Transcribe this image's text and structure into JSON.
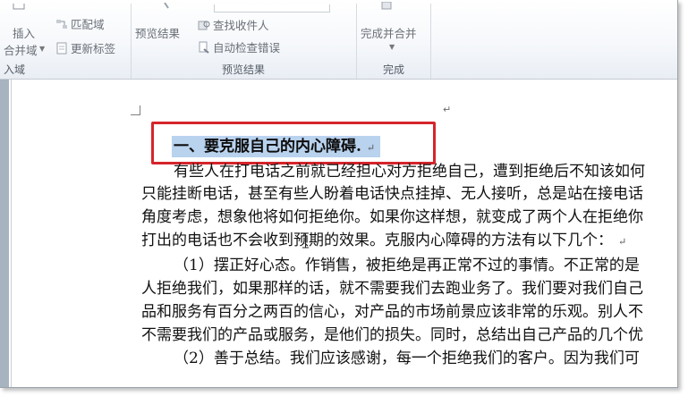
{
  "ribbon": {
    "insert_label": "插入",
    "merge_field_label": "合并域",
    "match_fields_label": "匹配域",
    "update_labels_label": "更新标签",
    "group_fields_label": "入域",
    "preview_results_button": "预览结果",
    "find_recipient_label": "查找收件人",
    "auto_check_errors_label": "自动检查错误",
    "group_preview_label": "预览结果",
    "finish_merge_label": "完成并合并",
    "group_finish_label": "完成"
  },
  "document": {
    "heading": "一、要克服自己的内心障碍.",
    "lines": [
      "有些人在打电话之前就已经担心对方拒绝自己，遭到拒绝后不知该如何",
      "只能挂断电话，甚至有些人盼着电话快点挂掉、无人接听，总是站在接电话",
      "角度考虑，想象他将如何拒绝你。如果你这样想，就变成了两个人在拒绝你",
      "打出的电话也不会收到预期的效果。克服内心障碍的方法有以下几个：",
      "（1）摆正好心态。作销售，被拒绝是再正常不过的事情。不正常的是",
      "人拒绝我们，如果那样的话，就不需要我们去跑业务了。我们要对我们自己",
      "品和服务有百分之两百的信心，对产品的市场前景应该非常的乐观。别人不",
      "不需要我们的产品或服务，是他们的损失。同时，总结出自己产品的几个优",
      "（2）善于总结。我们应该感谢，每一个拒绝我们的客户。因为我们可"
    ],
    "paragraph_mark": "↵"
  },
  "colors": {
    "highlight_box": "#d6242b",
    "selection": "#b9d2ee"
  }
}
